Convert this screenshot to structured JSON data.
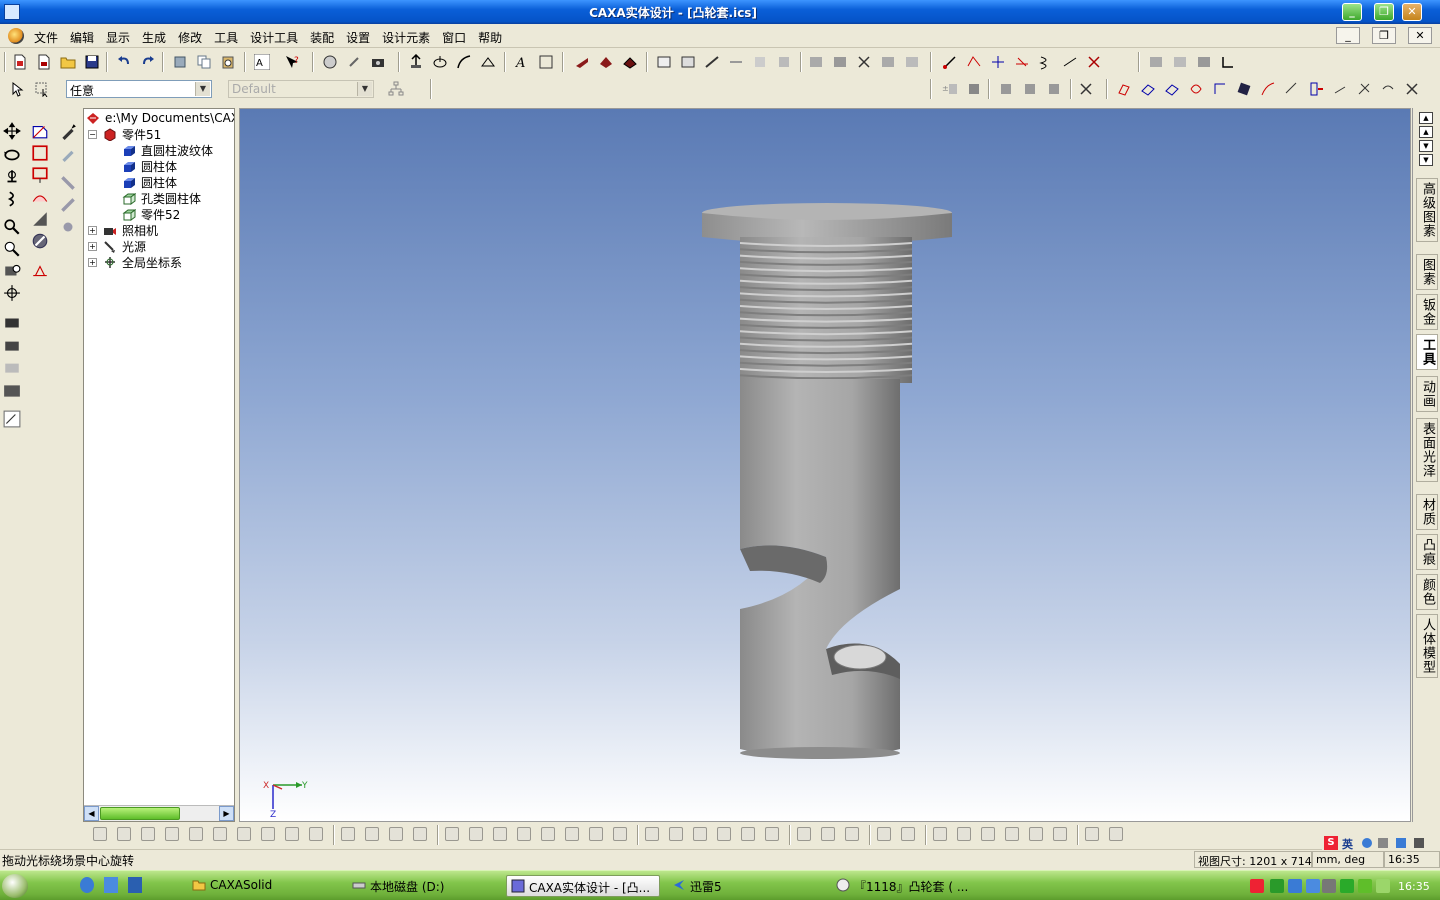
{
  "window": {
    "title": "CAXA实体设计 - [凸轮套.ics]"
  },
  "menu": {
    "items": [
      "文件",
      "编辑",
      "显示",
      "生成",
      "修改",
      "工具",
      "设计工具",
      "装配",
      "设置",
      "设计元素",
      "窗口",
      "帮助"
    ]
  },
  "toolbar": {
    "filter_value": "任意",
    "style_value": "Default"
  },
  "tree": {
    "root": "e:\\My Documents\\CAXASo",
    "part": "零件51",
    "children": [
      "直圆柱波纹体",
      "圆柱体",
      "圆柱体",
      "孔类圆柱体",
      "零件52"
    ],
    "camera": "照相机",
    "light": "光源",
    "global_coords": "全局坐标系"
  },
  "axis": {
    "x": "X",
    "y": "Y",
    "z": "Z"
  },
  "right_tabs": [
    "高级图素",
    "图素",
    "钣金",
    "工具",
    "动画",
    "表面光泽",
    "材质",
    "凸痕",
    "颜色",
    "人体模型"
  ],
  "right_tabs_active": "工具",
  "status": {
    "hint": "拖动光标绕场景中心旋转",
    "view_size": "视图尺寸: 1201 x 714",
    "units": "mm, deg",
    "time": "16:35",
    "ime": "英"
  },
  "taskbar": {
    "items": [
      "CAXASolid",
      "本地磁盘 (D:)",
      "CAXA实体设计 - [凸...",
      "迅雷5",
      "『1118』凸轮套 ( ..."
    ],
    "clock": "16:35"
  },
  "colors": {
    "titlebar": "#0553c7",
    "taskbar": "#6fb13b",
    "model": "#9a9a9a"
  }
}
